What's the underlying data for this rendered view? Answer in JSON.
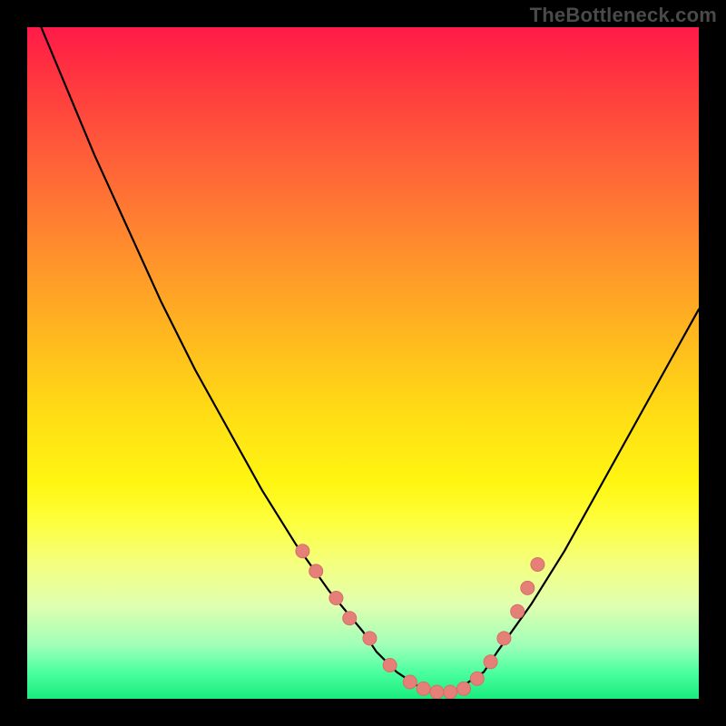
{
  "watermark": "TheBottleneck.com",
  "colors": {
    "frame": "#000000",
    "curve": "#000000",
    "marker_fill": "#e48078",
    "marker_stroke": "#d86e66",
    "gradient_top": "#ff1a49",
    "gradient_bottom": "#19ec7e"
  },
  "chart_data": {
    "type": "line",
    "title": "",
    "xlabel": "",
    "ylabel": "",
    "xlim": [
      0,
      100
    ],
    "ylim": [
      0,
      100
    ],
    "series": [
      {
        "name": "bottleneck-curve",
        "x": [
          0,
          5,
          10,
          15,
          20,
          25,
          30,
          35,
          40,
          45,
          50,
          52,
          55,
          58,
          60,
          63,
          65,
          68,
          70,
          75,
          80,
          85,
          90,
          95,
          100
        ],
        "y": [
          105,
          93,
          81,
          70,
          59,
          49,
          40,
          31,
          23,
          16,
          10,
          7,
          4,
          2,
          1,
          1,
          2,
          4,
          7,
          14,
          22,
          31,
          40,
          49,
          58
        ]
      }
    ],
    "markers": {
      "name": "highlight-points",
      "x": [
        41,
        43,
        46,
        48,
        51,
        54,
        57,
        59,
        61,
        63,
        65,
        67,
        69,
        71,
        73,
        74.5,
        76
      ],
      "y": [
        22,
        19,
        15,
        12,
        9,
        5,
        2.5,
        1.5,
        1,
        1,
        1.5,
        3,
        5.5,
        9,
        13,
        16.5,
        20
      ]
    }
  }
}
